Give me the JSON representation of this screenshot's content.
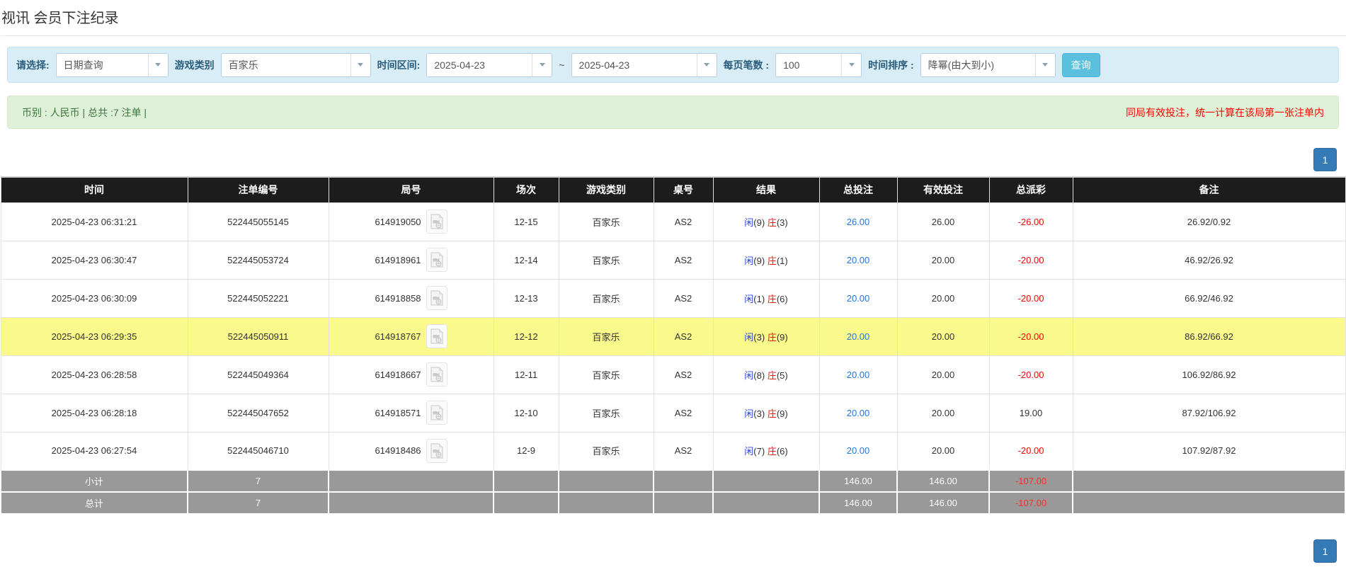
{
  "page": {
    "title": "视讯 会员下注纪录"
  },
  "filter_bar": {
    "select_label": "请选择:",
    "select_value": "日期查询",
    "game_type_label": "游戏类别",
    "game_type_value": "百家乐",
    "date_range_label": "时间区间:",
    "date_from": "2025-04-23",
    "date_separator": "~",
    "date_to": "2025-04-23",
    "page_size_label": "每页笔数 :",
    "page_size_value": "100",
    "sort_label": "时间排序 :",
    "sort_value": "降幂(由大到小)",
    "search_button": "查询"
  },
  "summary_bar": {
    "left_text": "币别 : 人民币 | 总共 :7 注单 |",
    "right_notice": "同局有效投注，统一计算在该局第一张注单内"
  },
  "pagination": {
    "page": "1"
  },
  "table": {
    "headers": [
      "时间",
      "注单编号",
      "局号",
      "场次",
      "游戏类别",
      "桌号",
      "结果",
      "总投注",
      "有效投注",
      "总派彩",
      "备注"
    ],
    "rows": [
      {
        "time": "2025-04-23 06:31:21",
        "bet_no": "522445055145",
        "round_no": "614919050",
        "session": "12-15",
        "game": "百家乐",
        "table_no": "AS2",
        "result": {
          "player": "闲",
          "player_score": "(9)",
          "banker": "庄",
          "banker_score": "(3)"
        },
        "total_bet": "26.00",
        "valid_bet": "26.00",
        "payout": "-26.00",
        "payout_negative": true,
        "remark": "26.92/0.92",
        "highlight": false
      },
      {
        "time": "2025-04-23 06:30:47",
        "bet_no": "522445053724",
        "round_no": "614918961",
        "session": "12-14",
        "game": "百家乐",
        "table_no": "AS2",
        "result": {
          "player": "闲",
          "player_score": "(9)",
          "banker": "庄",
          "banker_score": "(1)"
        },
        "total_bet": "20.00",
        "valid_bet": "20.00",
        "payout": "-20.00",
        "payout_negative": true,
        "remark": "46.92/26.92",
        "highlight": false
      },
      {
        "time": "2025-04-23 06:30:09",
        "bet_no": "522445052221",
        "round_no": "614918858",
        "session": "12-13",
        "game": "百家乐",
        "table_no": "AS2",
        "result": {
          "player": "闲",
          "player_score": "(1)",
          "banker": "庄",
          "banker_score": "(6)"
        },
        "total_bet": "20.00",
        "valid_bet": "20.00",
        "payout": "-20.00",
        "payout_negative": true,
        "remark": "66.92/46.92",
        "highlight": false
      },
      {
        "time": "2025-04-23 06:29:35",
        "bet_no": "522445050911",
        "round_no": "614918767",
        "session": "12-12",
        "game": "百家乐",
        "table_no": "AS2",
        "result": {
          "player": "闲",
          "player_score": "(3)",
          "banker": "庄",
          "banker_score": "(9)"
        },
        "total_bet": "20.00",
        "valid_bet": "20.00",
        "payout": "-20.00",
        "payout_negative": true,
        "remark": "86.92/66.92",
        "highlight": true
      },
      {
        "time": "2025-04-23 06:28:58",
        "bet_no": "522445049364",
        "round_no": "614918667",
        "session": "12-11",
        "game": "百家乐",
        "table_no": "AS2",
        "result": {
          "player": "闲",
          "player_score": "(8)",
          "banker": "庄",
          "banker_score": "(5)"
        },
        "total_bet": "20.00",
        "valid_bet": "20.00",
        "payout": "-20.00",
        "payout_negative": true,
        "remark": "106.92/86.92",
        "highlight": false
      },
      {
        "time": "2025-04-23 06:28:18",
        "bet_no": "522445047652",
        "round_no": "614918571",
        "session": "12-10",
        "game": "百家乐",
        "table_no": "AS2",
        "result": {
          "player": "闲",
          "player_score": "(3)",
          "banker": "庄",
          "banker_score": "(9)"
        },
        "total_bet": "20.00",
        "valid_bet": "20.00",
        "payout": "19.00",
        "payout_negative": false,
        "remark": "87.92/106.92",
        "highlight": false
      },
      {
        "time": "2025-04-23 06:27:54",
        "bet_no": "522445046710",
        "round_no": "614918486",
        "session": "12-9",
        "game": "百家乐",
        "table_no": "AS2",
        "result": {
          "player": "闲",
          "player_score": "(7)",
          "banker": "庄",
          "banker_score": "(6)"
        },
        "total_bet": "20.00",
        "valid_bet": "20.00",
        "payout": "-20.00",
        "payout_negative": true,
        "remark": "107.92/87.92",
        "highlight": false
      }
    ],
    "footer_rows": [
      {
        "label": "小计",
        "count": "7",
        "total_bet": "146.00",
        "valid_bet": "146.00",
        "payout": "-107.00"
      },
      {
        "label": "总计",
        "count": "7",
        "total_bet": "146.00",
        "valid_bet": "146.00",
        "payout": "-107.00"
      }
    ]
  },
  "colors": {
    "header_bg": "#1c1c1c",
    "highlight_row": "#f9f98c",
    "totals_bg": "#999999",
    "link_blue": "#2277e5",
    "loss_red": "#ff0000",
    "player_blue": "#2b46d9",
    "banker_red": "#e8160c",
    "filter_bg": "#d9edf7",
    "summary_bg": "#dff0d8",
    "pagination_blue": "#337ab7",
    "search_btn": "#5bc0de"
  }
}
